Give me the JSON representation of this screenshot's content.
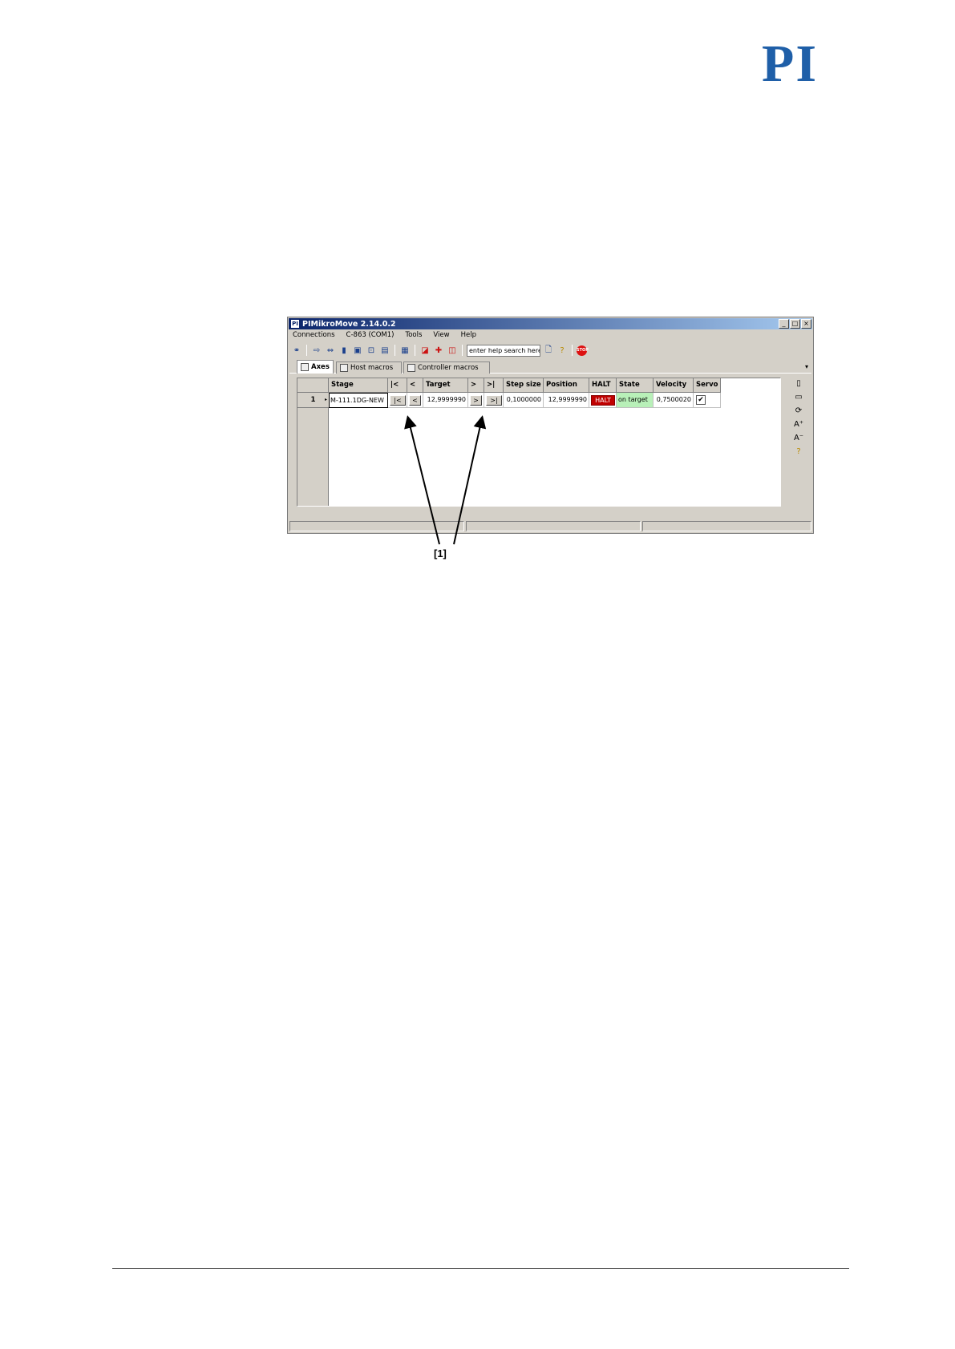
{
  "logo": "PI",
  "window": {
    "title": "PIMikroMove  2.14.0.2",
    "app_icon": "PI",
    "buttons": [
      "_",
      "□",
      "×"
    ]
  },
  "menu": [
    "Connections",
    "C-863 (COM1)",
    "Tools",
    "View",
    "Help"
  ],
  "toolbar": {
    "search_placeholder": "enter help search here",
    "stop_label": "STOP"
  },
  "tabs": [
    {
      "label": "Axes",
      "active": true
    },
    {
      "label": "Host macros",
      "active": false
    },
    {
      "label": "Controller macros",
      "active": false
    }
  ],
  "grid": {
    "headers": [
      "Stage",
      "|<",
      "<",
      "Target",
      ">",
      ">|",
      "Step size",
      "Position",
      "HALT",
      "State",
      "Velocity",
      "Servo"
    ],
    "rows": [
      {
        "num": "1",
        "stage": "M-111.1DG-NEW",
        "btn_first": "|<",
        "btn_prev": "<",
        "target": "12,9999990",
        "btn_next": ">",
        "btn_last": ">|",
        "step_size": "0,1000000",
        "position": "12,9999990",
        "halt": "HALT",
        "state": "on target",
        "velocity": "0,7500020",
        "servo": "✔"
      }
    ]
  },
  "callout": "[1]",
  "colors": {
    "halt": "#c00000",
    "on_target": "#b8f0b8",
    "logo": "#1f5fa8",
    "titlebar": "#0a246a"
  }
}
